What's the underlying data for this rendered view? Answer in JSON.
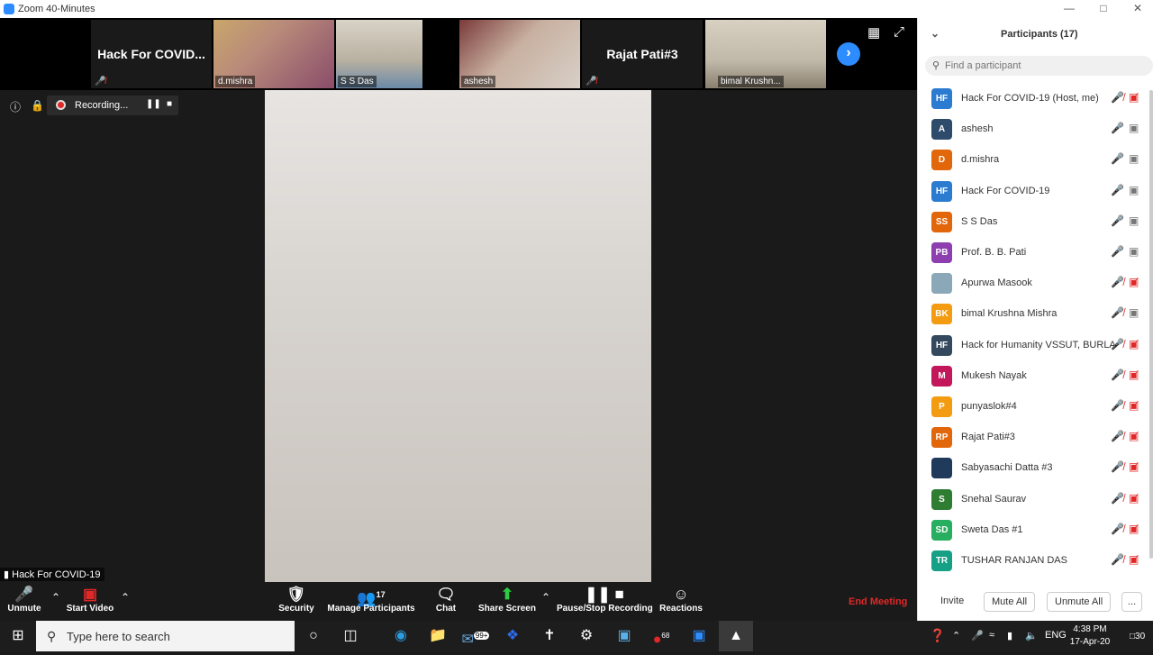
{
  "window": {
    "title": "Zoom 40-Minutes"
  },
  "gallery": {
    "tiles": [
      {
        "name": "Hack For COVID..."
      },
      {
        "name": "d.mishra"
      },
      {
        "name": "S S Das"
      },
      {
        "name": "ashesh"
      },
      {
        "name": "Rajat Pati#3"
      },
      {
        "name": "bimal Krushn..."
      }
    ]
  },
  "recording": {
    "label": "Recording..."
  },
  "main": {
    "speaker_name": "Hack For COVID-19"
  },
  "toolbar": {
    "unmute": "Unmute",
    "start_video": "Start Video",
    "security": "Security",
    "manage_participants": "Manage Participants",
    "participant_count": "17",
    "chat": "Chat",
    "share_screen": "Share Screen",
    "pause_stop_recording": "Pause/Stop Recording",
    "reactions": "Reactions",
    "end_meeting": "End Meeting"
  },
  "participants_panel": {
    "title": "Participants (17)",
    "search_placeholder": "Find a participant",
    "participants": [
      {
        "initials": "HF",
        "name": "Hack For COVID-19 (Host, me)",
        "color": "#2b7bd0",
        "mic": "muted",
        "video": "off"
      },
      {
        "initials": "A",
        "name": "ashesh",
        "color": "#2e4b6b",
        "mic": "on",
        "video": "on"
      },
      {
        "initials": "D",
        "name": "d.mishra",
        "color": "#e2660a",
        "mic": "on",
        "video": "on"
      },
      {
        "initials": "HF",
        "name": "Hack For COVID-19",
        "color": "#2b7bd0",
        "mic": "on",
        "video": "on"
      },
      {
        "initials": "SS",
        "name": "S S Das",
        "color": "#e2660a",
        "mic": "on",
        "video": "on"
      },
      {
        "initials": "PB",
        "name": "Prof. B. B. Pati",
        "color": "#8d3fb0",
        "mic": "on",
        "video": "on"
      },
      {
        "initials": "",
        "name": "Apurwa Masook",
        "color": "#8aa8b8",
        "mic": "muted",
        "video": "off"
      },
      {
        "initials": "BK",
        "name": "bimal Krushna Mishra",
        "color": "#f39c12",
        "mic": "muted",
        "video": "on"
      },
      {
        "initials": "HF",
        "name": "Hack for Humanity VSSUT, BURLA",
        "color": "#34495e",
        "mic": "muted",
        "video": "off"
      },
      {
        "initials": "M",
        "name": "Mukesh Nayak",
        "color": "#c2185b",
        "mic": "muted",
        "video": "off"
      },
      {
        "initials": "P",
        "name": "punyaslok#4",
        "color": "#f39c12",
        "mic": "muted",
        "video": "off"
      },
      {
        "initials": "RP",
        "name": "Rajat Pati#3",
        "color": "#e2660a",
        "mic": "muted",
        "video": "off"
      },
      {
        "initials": "",
        "name": "Sabyasachi Datta #3",
        "color": "#1f3a5a",
        "mic": "muted",
        "video": "off"
      },
      {
        "initials": "S",
        "name": "Snehal Saurav",
        "color": "#2e7d32",
        "mic": "muted",
        "video": "off"
      },
      {
        "initials": "SD",
        "name": "Sweta Das #1",
        "color": "#27ae60",
        "mic": "muted",
        "video": "off"
      },
      {
        "initials": "TR",
        "name": "TUSHAR RANJAN DAS",
        "color": "#16a085",
        "mic": "muted",
        "video": "off"
      }
    ],
    "buttons": {
      "invite": "Invite",
      "mute_all": "Mute All",
      "unmute_all": "Unmute All",
      "more": "..."
    }
  },
  "taskbar": {
    "search_placeholder": "Type here to search",
    "mail_badge": "99+",
    "app_badge": "68",
    "language": "ENG",
    "time": "4:38 PM",
    "date": "17-Apr-20",
    "notification_count": "30"
  }
}
